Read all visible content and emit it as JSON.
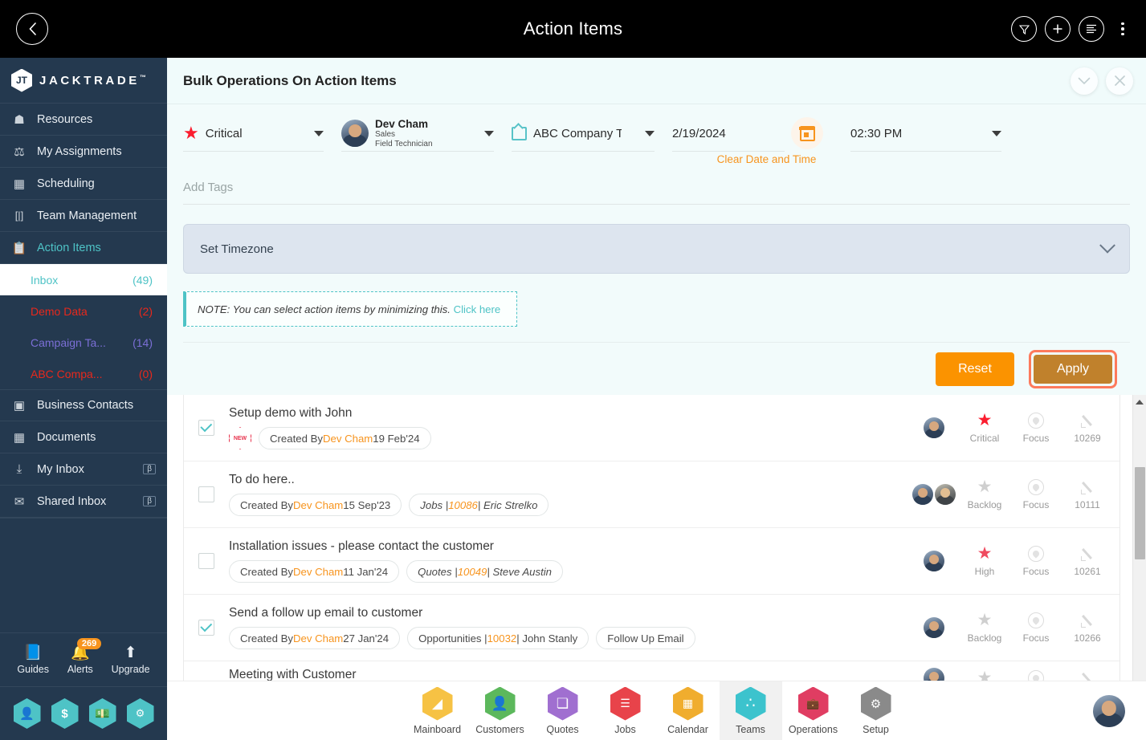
{
  "topbar": {
    "title": "Action Items",
    "back_icon": "chevron-left-icon",
    "actions": [
      {
        "name": "filter-icon",
        "glyph": "▽"
      },
      {
        "name": "add-icon",
        "glyph": "+"
      },
      {
        "name": "list-view-icon",
        "glyph": "≡"
      }
    ],
    "overflow_icon": "kebab-menu-icon"
  },
  "sidebar": {
    "brand": {
      "mark": "JT",
      "text": "JACKTRADE",
      "tm": "™"
    },
    "items": [
      {
        "label": "Resources",
        "icon": "resources-icon",
        "glyph": "⚘",
        "active": false
      },
      {
        "label": "My Assignments",
        "icon": "assignments-icon",
        "glyph": "⚒",
        "active": false
      },
      {
        "label": "Scheduling",
        "icon": "scheduling-icon",
        "glyph": "▤",
        "active": false
      },
      {
        "label": "Team Management",
        "icon": "team-management-icon",
        "glyph": "[|]",
        "active": false
      },
      {
        "label": "Action Items",
        "icon": "action-items-icon",
        "glyph": "▤",
        "active": true
      }
    ],
    "sub_items": [
      {
        "label": "Inbox",
        "count": "(49)",
        "color": "#4ec3c6",
        "selected": true
      },
      {
        "label": "Demo Data",
        "count": "(2)",
        "color": "#e8281c",
        "selected": false
      },
      {
        "label": "Campaign Ta...",
        "count": "(14)",
        "color": "#7b6fd6",
        "selected": false
      },
      {
        "label": "ABC Compa...",
        "count": "(0)",
        "color": "#e8281c",
        "selected": false
      }
    ],
    "items_after": [
      {
        "label": "Business Contacts",
        "icon": "business-contacts-icon",
        "glyph": "▣",
        "beta": ""
      },
      {
        "label": "Documents",
        "icon": "documents-icon",
        "glyph": "▤",
        "beta": ""
      },
      {
        "label": "My Inbox",
        "icon": "my-inbox-icon",
        "glyph": "⤓",
        "beta": "β"
      },
      {
        "label": "Shared Inbox",
        "icon": "shared-inbox-icon",
        "glyph": "✉",
        "beta": "β"
      }
    ],
    "utils": [
      {
        "label": "Guides",
        "icon": "guides-icon",
        "glyph": "▯",
        "badge": ""
      },
      {
        "label": "Alerts",
        "icon": "bell-icon",
        "glyph": "🔔",
        "badge": "269"
      },
      {
        "label": "Upgrade",
        "icon": "upgrade-arrow-icon",
        "glyph": "⬆",
        "badge": ""
      }
    ],
    "hex_shortcuts": [
      {
        "name": "contact-hex-icon",
        "glyph": "👤"
      },
      {
        "name": "billing-hex-icon",
        "glyph": "$"
      },
      {
        "name": "payments-hex-icon",
        "glyph": "💵"
      },
      {
        "name": "workflow-hex-icon",
        "glyph": "⚙"
      }
    ]
  },
  "panel": {
    "title": "Bulk Operations On Action Items",
    "collapse_icon": "chevron-down-icon",
    "close_icon": "close-icon"
  },
  "form": {
    "priority": {
      "label": "Critical",
      "icon": "star-icon",
      "color": "#fb1d2f"
    },
    "assignee": {
      "name": "Dev Cham",
      "dept": "Sales",
      "role": "Field Technician",
      "avatar": "user-avatar"
    },
    "company": {
      "label": "ABC Company T",
      "icon": "company-icon",
      "color": "#58c3c8"
    },
    "date": {
      "value": "2/19/2024",
      "calendar_icon": "calendar-icon",
      "clear_label": "Clear Date and Time"
    },
    "time": {
      "value": "02:30 PM"
    },
    "tags": {
      "placeholder": "Add Tags"
    },
    "timezone": {
      "label": "Set Timezone",
      "chevron": "chevron-down-icon"
    },
    "note": {
      "text": "NOTE: You can select action items by minimizing this.",
      "link": "Click here"
    },
    "buttons": {
      "reset": "Reset",
      "apply": "Apply"
    }
  },
  "list": {
    "items": [
      {
        "checked": true,
        "title": "Setup demo with John",
        "new_badge": "NEW",
        "chips": [
          {
            "prefix": "Created By ",
            "name": "Dev Cham",
            "suffix": " 19 Feb'24",
            "italic": false
          }
        ],
        "avatars": 1,
        "priority": {
          "label": "Critical",
          "color": "#fb1d2f",
          "filled": true
        },
        "focus": {
          "label": "Focus"
        },
        "id": "10269"
      },
      {
        "checked": false,
        "title": "To do here..",
        "new_badge": "",
        "chips": [
          {
            "prefix": "Created By ",
            "name": "Dev Cham",
            "suffix": " 15 Sep'23",
            "italic": false
          },
          {
            "prefix": "Jobs | ",
            "name": "10086",
            "suffix": " | Eric Strelko",
            "italic": true
          }
        ],
        "avatars": 2,
        "priority": {
          "label": "Backlog",
          "color": "#cfcfcf",
          "filled": true
        },
        "focus": {
          "label": "Focus"
        },
        "id": "10111"
      },
      {
        "checked": false,
        "title": "Installation issues - please contact the customer",
        "new_badge": "",
        "chips": [
          {
            "prefix": "Created By ",
            "name": "Dev Cham",
            "suffix": " 11 Jan'24",
            "italic": false
          },
          {
            "prefix": "Quotes | ",
            "name": "10049",
            "suffix": " | Steve Austin",
            "italic": true
          }
        ],
        "avatars": 1,
        "priority": {
          "label": "High",
          "color": "#ef4a5f",
          "filled": true
        },
        "focus": {
          "label": "Focus"
        },
        "id": "10261"
      },
      {
        "checked": true,
        "title": "Send a follow up email to customer",
        "new_badge": "",
        "chips": [
          {
            "prefix": "Created By ",
            "name": "Dev Cham",
            "suffix": " 27 Jan'24",
            "italic": false
          },
          {
            "prefix": "Opportunities | ",
            "name": "10032",
            "suffix": " | John Stanly",
            "italic": false
          },
          {
            "prefix": "Follow Up Email",
            "name": "",
            "suffix": "",
            "italic": false
          }
        ],
        "avatars": 1,
        "priority": {
          "label": "Backlog",
          "color": "#cfcfcf",
          "filled": true
        },
        "focus": {
          "label": "Focus"
        },
        "id": "10266"
      },
      {
        "checked": false,
        "title": "Meeting with Customer",
        "new_badge": "",
        "chips": [],
        "avatars": 1,
        "priority": {
          "label": "",
          "color": "#cfcfcf",
          "filled": true
        },
        "focus": {
          "label": ""
        },
        "id": ""
      }
    ]
  },
  "bottomnav": {
    "items": [
      {
        "label": "Mainboard",
        "color": "#f6c244",
        "icon": "mainboard-icon",
        "glyph": "◣",
        "active": false
      },
      {
        "label": "Customers",
        "color": "#5cb85c",
        "icon": "customers-icon",
        "glyph": "👤",
        "active": false
      },
      {
        "label": "Quotes",
        "color": "#a06fd0",
        "icon": "quotes-icon",
        "glyph": "❏",
        "active": false
      },
      {
        "label": "Jobs",
        "color": "#e8434a",
        "icon": "jobs-icon",
        "glyph": "☰",
        "active": false
      },
      {
        "label": "Calendar",
        "color": "#f0ad2e",
        "icon": "calendar-icon",
        "glyph": "▦",
        "active": false
      },
      {
        "label": "Teams",
        "color": "#3cc3cd",
        "icon": "teams-icon",
        "glyph": "∴",
        "active": true
      },
      {
        "label": "Operations",
        "color": "#e03d62",
        "icon": "operations-icon",
        "glyph": "💼",
        "active": false
      },
      {
        "label": "Setup",
        "color": "#8a8a8a",
        "icon": "setup-icon",
        "glyph": "⚙",
        "active": false
      }
    ],
    "avatar": "profile-avatar"
  }
}
